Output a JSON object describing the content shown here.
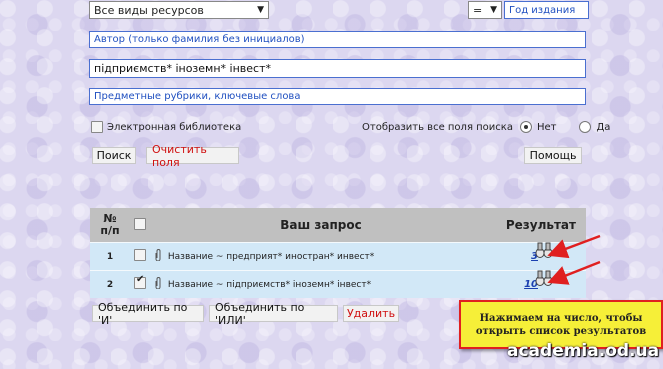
{
  "search": {
    "resource_type": "Все виды ресурсов",
    "year_operator": "=",
    "year_placeholder": "Год издания",
    "author_placeholder": "Автор (только фамилия без инициалов)",
    "query_value": "підприємств* іноземн* інвест*",
    "subjects_placeholder": "Предметные рубрики, ключевые слова",
    "electronic_library_label": "Электронная библиотека",
    "show_all_fields_label": "Отобразить все поля поиска",
    "option_no": "Нет",
    "option_yes": "Да",
    "search_button": "Поиск",
    "clear_button": "Очистить поля",
    "help_button": "Помощь"
  },
  "table": {
    "col_number": "№ п/п",
    "col_query": "Ваш запрос",
    "col_result": "Результат",
    "rows": [
      {
        "num": "1",
        "checked": false,
        "query": "Название ~ предприят* иностран* инвест*",
        "result": "3"
      },
      {
        "num": "2",
        "checked": true,
        "query": "Название ~ підприємств* іноземн* інвест*",
        "result": "10"
      }
    ]
  },
  "actions": {
    "combine_and": "Объединить по 'И'",
    "combine_or": "Объединить по 'ИЛИ'",
    "delete": "Удалить"
  },
  "annotation": {
    "callout_line1": "Нажимаем на число, чтобы",
    "callout_line2": "открыть список результатов",
    "watermark": "academia.od.ua"
  },
  "colors": {
    "callout_bg": "#f6ef38",
    "callout_border": "#e02020",
    "arrow": "#e02020",
    "table_row": "#d2e8f7"
  }
}
